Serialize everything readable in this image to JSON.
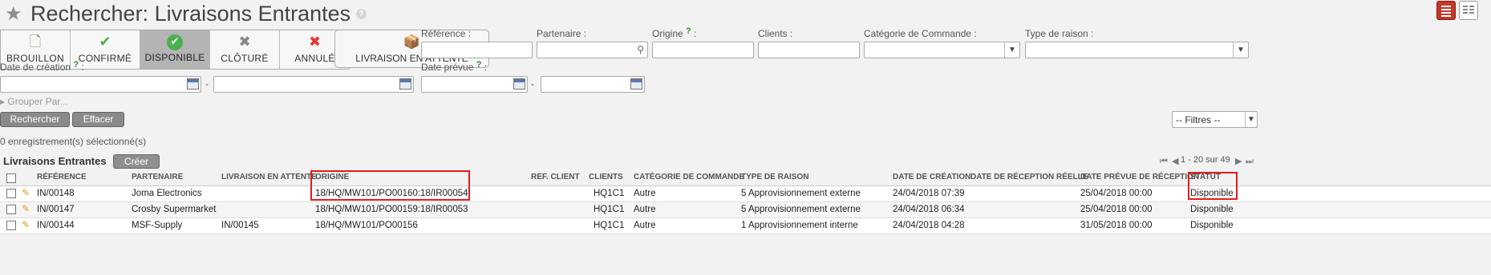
{
  "header": {
    "title": "Rechercher: Livraisons Entrantes",
    "help": "?"
  },
  "states": [
    {
      "label": "BROUILLON",
      "icon": "draft-icon",
      "glyph": "🗋",
      "color": "#7a9a6a",
      "active": false
    },
    {
      "label": "CONFIRMÉ",
      "icon": "check-icon",
      "glyph": "✔",
      "color": "#4caf50",
      "active": false
    },
    {
      "label": "DISPONIBLE",
      "icon": "available-check-icon",
      "glyph": "✔",
      "color": "#ffffff",
      "active": true
    },
    {
      "label": "CLÔTURÉ",
      "icon": "close-x-icon",
      "glyph": "✖",
      "color": "#888888",
      "active": false
    },
    {
      "label": "ANNULÉ",
      "icon": "cancel-icon",
      "glyph": "✖",
      "color": "#e53935",
      "active": false
    }
  ],
  "waiting_button": {
    "label": "LIVRAISON EN ATTENTE",
    "icon": "package-icon",
    "glyph": "📦"
  },
  "filters": {
    "reference": "Référence :",
    "partner": "Partenaire :",
    "origin": "Origine",
    "origin_help": "?",
    "clients": "Clients :",
    "order_category": "Catégorie de Commande :",
    "reason_type": "Type de raison :",
    "creation_date": "Date de création",
    "creation_help": "?",
    "planned_date": "Date prévue",
    "planned_help": "?",
    "colon": ":",
    "dash": "-"
  },
  "group_by": "Grouper Par...",
  "buttons": {
    "search": "Rechercher",
    "clear": "Effacer",
    "filters": "-- Filtres --",
    "create": "Créer"
  },
  "selected_count": "0 enregistrement(s) sélectionné(s)",
  "list": {
    "title": "Livraisons Entrantes",
    "pager": "1 - 20 sur 49",
    "columns": [
      "RÉFÉRENCE",
      "PARTENAIRE",
      "LIVRAISON EN ATTENTE",
      "ORIGINE",
      "REF. CLIENT",
      "CLIENTS",
      "CATÉGORIE DE COMMANDE",
      "TYPE DE RAISON",
      "DATE DE CRÉATION",
      "DATE DE RÉCEPTION RÉELLE",
      "DATE PRÉVUE DE RÉCEPTION",
      "STATUT"
    ],
    "rows": [
      {
        "ref": "IN/00148",
        "partner": "Joma Electronics",
        "waiting": "",
        "origin": "18/HQ/MW101/PO00160:18/IR00054",
        "client_ref": "",
        "clients": "HQ1C1",
        "category": "Autre",
        "reason": "5 Approvisionnement externe",
        "created": "24/04/2018 07:39",
        "received": "",
        "planned": "25/04/2018 00:00",
        "status": "Disponible"
      },
      {
        "ref": "IN/00147",
        "partner": "Crosby Supermarket",
        "waiting": "",
        "origin": "18/HQ/MW101/PO00159:18/IR00053",
        "client_ref": "",
        "clients": "HQ1C1",
        "category": "Autre",
        "reason": "5 Approvisionnement externe",
        "created": "24/04/2018 06:34",
        "received": "",
        "planned": "25/04/2018 00:00",
        "status": "Disponible"
      },
      {
        "ref": "IN/00144",
        "partner": "MSF-Supply",
        "waiting": "IN/00145",
        "origin": "18/HQ/MW101/PO00156",
        "client_ref": "",
        "clients": "HQ1C1",
        "category": "Autre",
        "reason": "1 Approvisionnement interne",
        "created": "24/04/2018 04:28",
        "received": "",
        "planned": "31/05/2018 00:00",
        "status": "Disponible"
      }
    ]
  },
  "colors": {
    "highlight": "#e31b1b",
    "active_state": "#b4b4b4",
    "list_view": "#c0392b"
  }
}
